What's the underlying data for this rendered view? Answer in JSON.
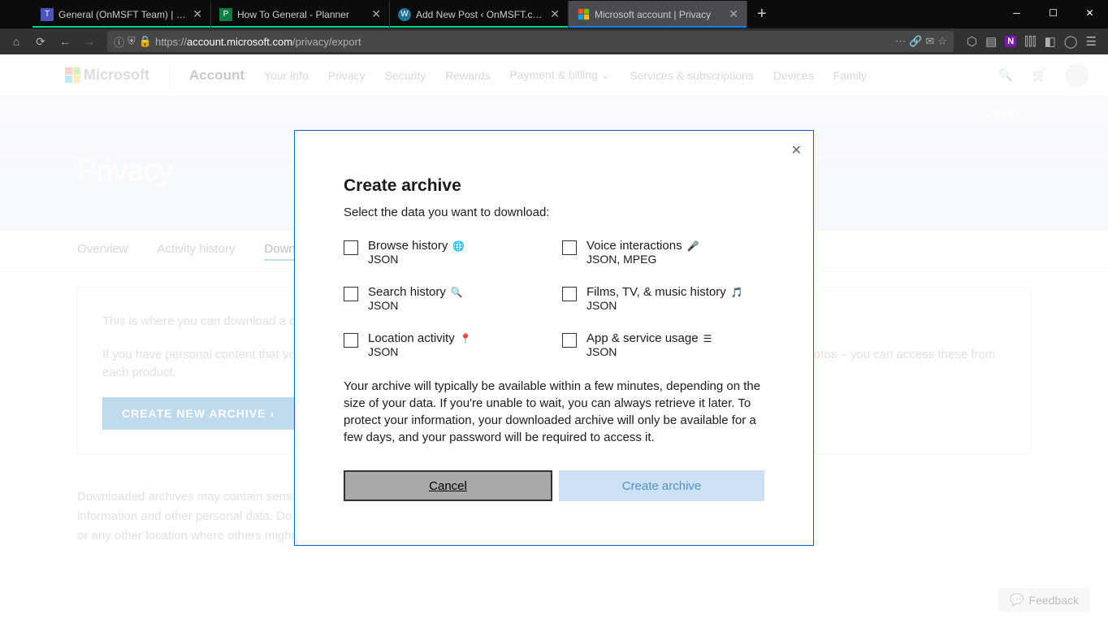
{
  "browser": {
    "tabs": [
      {
        "title": "General (OnMSFT Team) | Micr"
      },
      {
        "title": "How To General - Planner"
      },
      {
        "title": "Add New Post ‹ OnMSFT.com — W"
      },
      {
        "title": "Microsoft account | Privacy"
      }
    ],
    "url_prefix": "https://",
    "url_domain": "account.microsoft.com",
    "url_path": "/privacy/export"
  },
  "header": {
    "brand": "Microsoft",
    "account": "Account",
    "nav": [
      "Your info",
      "Privacy",
      "Security",
      "Rewards",
      "Payment & billing",
      "Services & subscriptions",
      "Devices",
      "Family"
    ]
  },
  "hero": {
    "title": "Privacy",
    "controlled": "controlled"
  },
  "subnav": {
    "overview": "Overview",
    "activity": "Activity history",
    "download": "Download your data"
  },
  "card": {
    "p1": "This is where you can download a copy of your data. To view and clear the data from a specific category go to activity history page.",
    "p2": "If you have personal content that you've accumulated using other Microsoft services and products – like your email, calendar and photos – you can access these from each product.",
    "button": "CREATE NEW ARCHIVE  ›"
  },
  "note": "Downloaded archives may contain sensitive content, such as your search history, location information and other personal data. Do not download your archive to a public computer or any other location where others might be able to access it.",
  "feedback": "Feedback",
  "modal": {
    "title": "Create archive",
    "subtitle": "Select the data you want to download:",
    "options": [
      {
        "label": "Browse history",
        "icon": "🌐",
        "format": "JSON"
      },
      {
        "label": "Voice interactions",
        "icon": "🎤",
        "format": "JSON, MPEG"
      },
      {
        "label": "Search history",
        "icon": "🔍",
        "format": "JSON"
      },
      {
        "label": "Films, TV, & music history",
        "icon": "🎵",
        "format": "JSON"
      },
      {
        "label": "Location activity",
        "icon": "📍",
        "format": "JSON"
      },
      {
        "label": "App & service usage",
        "icon": "☰",
        "format": "JSON"
      }
    ],
    "disclaimer": "Your archive will typically be available within a few minutes, depending on the size of your data. If you're unable to wait, you can always retrieve it later. To protect your information, your downloaded archive will only be available for a few days, and your password will be required to access it.",
    "cancel": "Cancel",
    "create": "Create archive"
  }
}
